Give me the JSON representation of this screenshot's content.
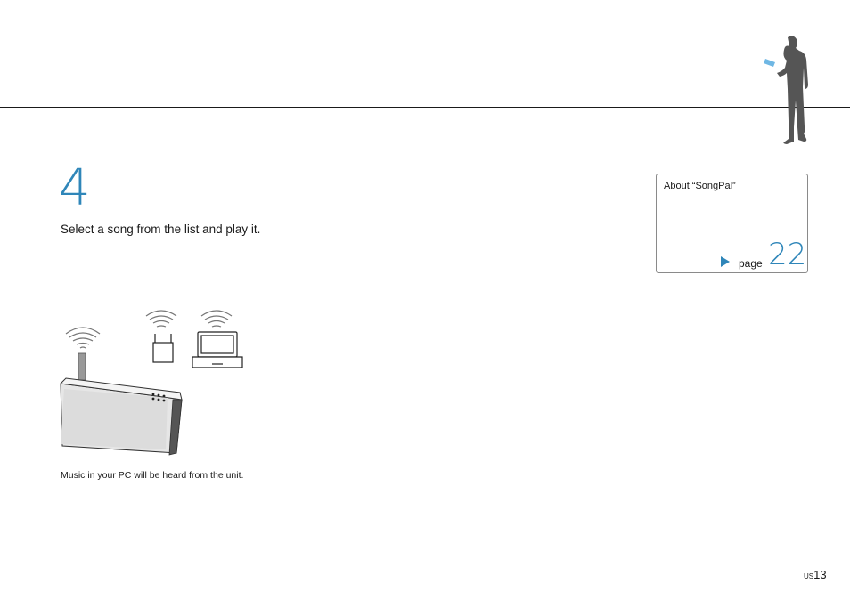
{
  "step": {
    "number": "4",
    "instruction": "Select a song from the list and play it."
  },
  "reference": {
    "title": "About “SongPal”",
    "page_word": "page",
    "page_number": "22",
    "arrow_icon": "play-triangle-icon"
  },
  "illustration": {
    "caption": "Music in your PC will be heard from the unit."
  },
  "footer": {
    "lang": "US",
    "page": "13"
  },
  "colors": {
    "accent": "#2f86b9",
    "text": "#1a1a1a",
    "border": "#8a8a8a"
  }
}
